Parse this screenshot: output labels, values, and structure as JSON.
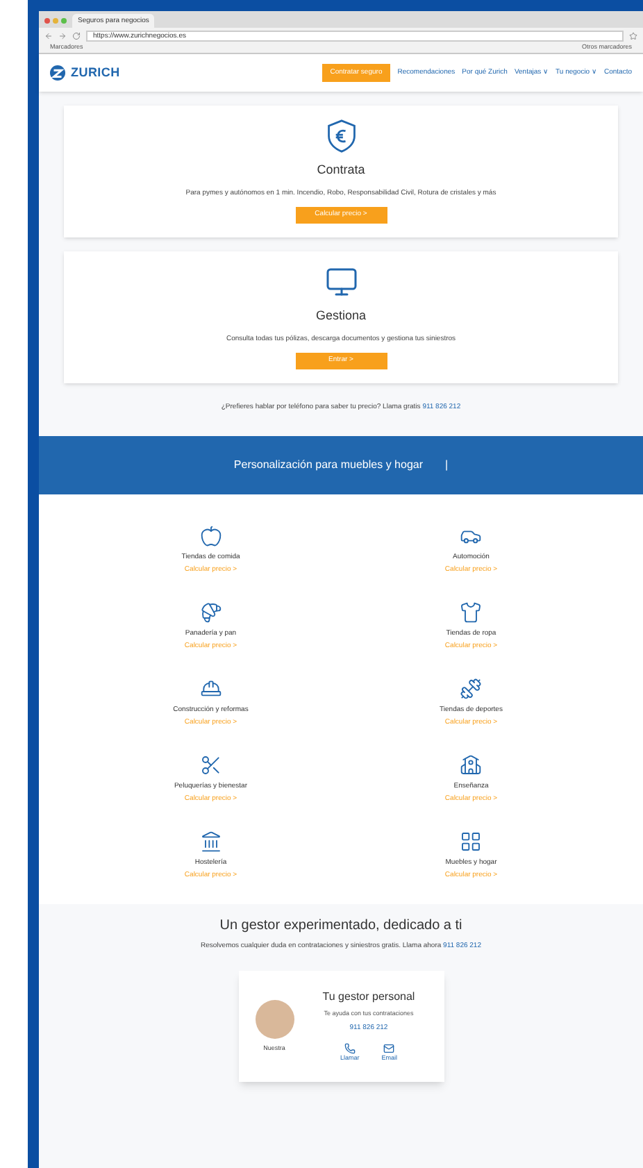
{
  "browser": {
    "tab_title": "Seguros para negocios",
    "url": "https://www.zurichnegocios.es",
    "bookmarks": [
      "Marcadores",
      "Otros marcadores"
    ]
  },
  "header": {
    "logo": "ZURICH",
    "nav": [
      {
        "label": "Contratar seguro",
        "kind": "cta"
      },
      {
        "label": "Recomendaciones",
        "kind": "link"
      },
      {
        "label": "Por qué Zurich",
        "kind": "link"
      },
      {
        "label": "Ventajas ∨",
        "kind": "link"
      },
      {
        "label": "Tu negocio ∨",
        "kind": "link"
      },
      {
        "label": "Contacto",
        "kind": "link"
      }
    ]
  },
  "cards": [
    {
      "kind": "shield",
      "title": "Contrata",
      "text": "Para pymes y autónomos en 1 min. Incendio, Robo, Responsabilidad Civil, Rotura de cristales y más",
      "button": "Calcular precio >"
    },
    {
      "kind": "monitor",
      "title": "Gestiona",
      "text": "Consulta todas tus pólizas, descarga documentos y gestiona tus siniestros",
      "button": "Entrar >"
    }
  ],
  "phone_note": {
    "text": "¿Prefieres hablar por teléfono para saber tu precio? Llama gratis",
    "phone": "911 826 212"
  },
  "banner": {
    "title": "Personalización para muebles y hogar",
    "cursor": "|"
  },
  "categories": [
    {
      "kind": "apple",
      "name": "Tiendas de comida",
      "link": "Calcular precio >"
    },
    {
      "kind": "car",
      "name": "Automoción",
      "link": "Calcular precio >"
    },
    {
      "kind": "bread",
      "name": "Panadería y pan",
      "link": "Calcular precio >"
    },
    {
      "kind": "shirt",
      "name": "Tiendas de ropa",
      "link": "Calcular precio >"
    },
    {
      "kind": "hardhat",
      "name": "Construcción y reformas",
      "link": "Calcular precio >"
    },
    {
      "kind": "sport",
      "name": "Tiendas de deportes",
      "link": "Calcular precio >"
    },
    {
      "kind": "scissors",
      "name": "Peluquerías y bienestar",
      "link": "Calcular precio >"
    },
    {
      "kind": "school",
      "name": "Enseñanza",
      "link": "Calcular precio >"
    },
    {
      "kind": "building",
      "name": "Hostelería",
      "link": "Calcular precio >"
    },
    {
      "kind": "grid",
      "name": "Muebles y hogar",
      "link": "Calcular precio >"
    }
  ],
  "advisor": {
    "title": "Un gestor experimentado, dedicado a ti",
    "text": "Resolvemos cualquier duda en contrataciones y siniestros gratis. Llama ahora",
    "phone": "911 826 212",
    "card": {
      "name": "Nuestra",
      "title": "Tu gestor personal",
      "subtitle": "Te ayuda con tus contrataciones",
      "phone": "911 826 212",
      "actions": [
        {
          "kind": "phone",
          "label": "Llamar"
        },
        {
          "kind": "mail",
          "label": "Email"
        }
      ]
    }
  }
}
